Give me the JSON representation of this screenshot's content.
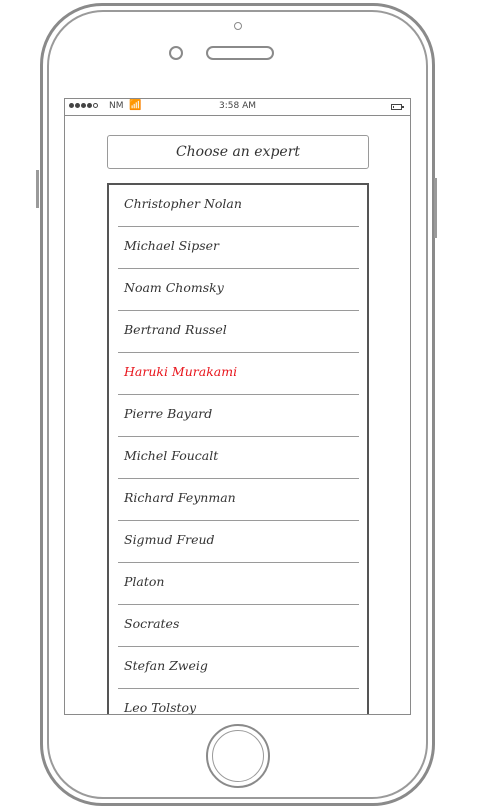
{
  "status_bar": {
    "carrier": "NM",
    "time": "3:58 AM",
    "signal_bars_filled": 4,
    "signal_bars_total": 5,
    "battery_level": 0.2
  },
  "choose_button": {
    "label": "Choose an expert"
  },
  "experts": [
    {
      "name": "Christopher Nolan",
      "selected": false
    },
    {
      "name": "Michael Sipser",
      "selected": false
    },
    {
      "name": "Noam Chomsky",
      "selected": false
    },
    {
      "name": "Bertrand Russel",
      "selected": false
    },
    {
      "name": "Haruki Murakami",
      "selected": true
    },
    {
      "name": "Pierre Bayard",
      "selected": false
    },
    {
      "name": "Michel Foucalt",
      "selected": false
    },
    {
      "name": "Richard Feynman",
      "selected": false
    },
    {
      "name": "Sigmud Freud",
      "selected": false
    },
    {
      "name": "Platon",
      "selected": false
    },
    {
      "name": "Socrates",
      "selected": false
    },
    {
      "name": "Stefan Zweig",
      "selected": false
    },
    {
      "name": "Leo Tolstoy",
      "selected": false
    }
  ],
  "colors": {
    "selected_text": "#e8141b",
    "text": "#333333",
    "outline": "#8a8a8a"
  }
}
